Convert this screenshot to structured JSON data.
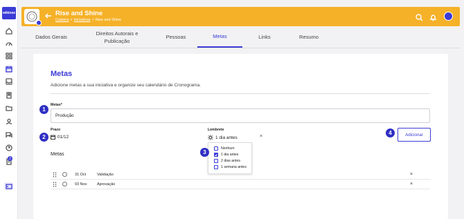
{
  "brand": {
    "logo_text": "wikinee",
    "accent": "#3b3bd6",
    "header_color": "#f5b128"
  },
  "rail": {
    "icons": [
      "home-icon",
      "dashboard-icon",
      "grid-icon",
      "calendar-icon",
      "inbox-icon",
      "book-icon",
      "folder-icon",
      "user-icon",
      "chat-icon",
      "help-icon",
      "notes-icon",
      "collapse-icon"
    ],
    "badge": "2"
  },
  "header": {
    "title": "Rise and Shine",
    "breadcrumbs": [
      "Cadeira",
      "Iniciativas",
      "Rise and Shine"
    ]
  },
  "tabs": [
    {
      "label": "Dados Gerais"
    },
    {
      "label": "Direitos Autorais e Publicação"
    },
    {
      "label": "Pessoas"
    },
    {
      "label": "Metas"
    },
    {
      "label": "Links"
    },
    {
      "label": "Resumo"
    }
  ],
  "active_tab": "Metas",
  "main": {
    "title": "Metas",
    "subtitle": "Adicione metas a sua iniciativa e organize seu calendário de Cronograma.",
    "metas_field": {
      "label": "Metas*",
      "value": "Produção"
    },
    "prazo": {
      "label": "Prazo",
      "value": "01/12"
    },
    "lembrete": {
      "label": "Lembrete",
      "value": "1 dia antes",
      "clear": "×",
      "options": [
        {
          "label": "Nenhum",
          "checked": false
        },
        {
          "label": "1 dia antes",
          "checked": true
        },
        {
          "label": "2 dias antes",
          "checked": false
        },
        {
          "label": "1 semana antes",
          "checked": false
        }
      ]
    },
    "add_button": "Adicionar",
    "list_label": "Metas",
    "rows": [
      {
        "date": "31 Oct",
        "description": "Validação",
        "remove": "×"
      },
      {
        "date": "03 Nov",
        "description": "Aprovação",
        "remove": "×"
      }
    ]
  },
  "markers": [
    "1",
    "2",
    "3",
    "4"
  ]
}
